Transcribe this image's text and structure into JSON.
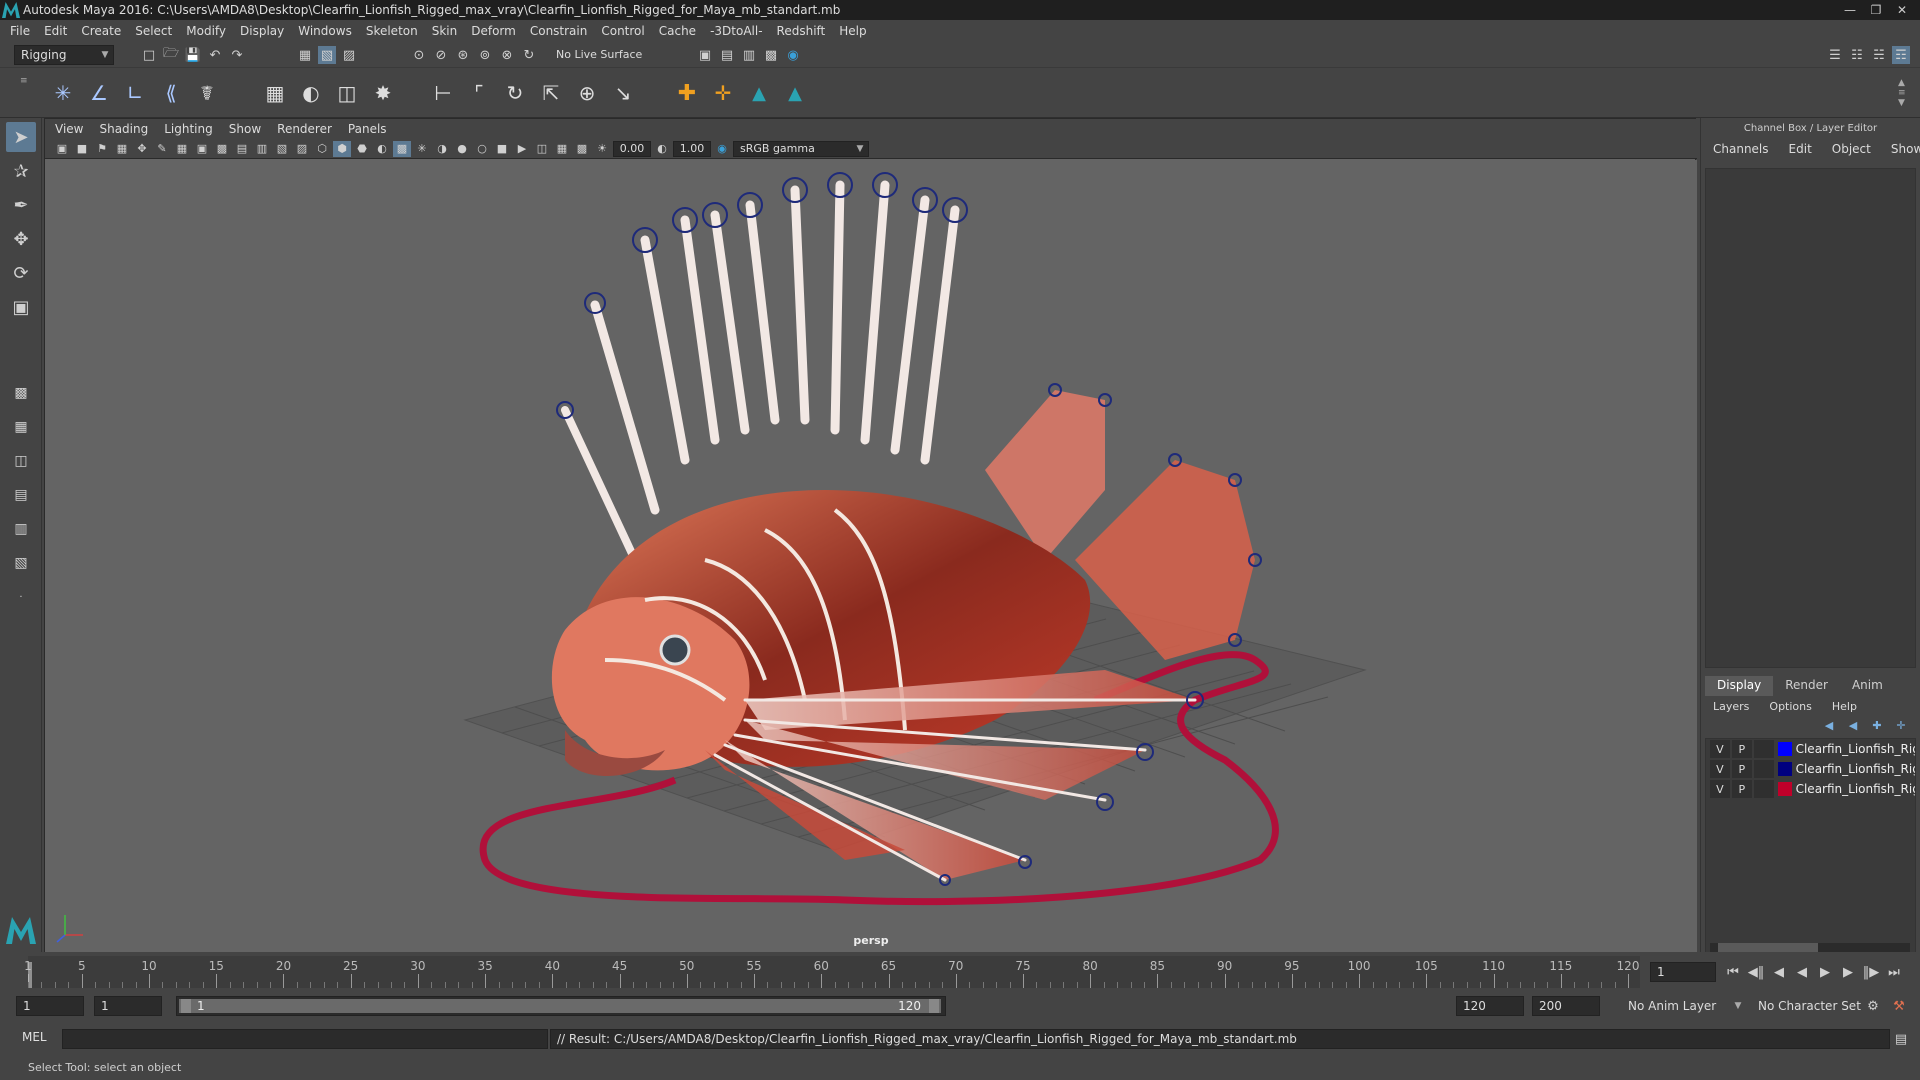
{
  "window": {
    "title": "Autodesk Maya 2016: C:\\Users\\AMDA8\\Desktop\\Clearfin_Lionfish_Rigged_max_vray\\Clearfin_Lionfish_Rigged_for_Maya_mb_standart.mb"
  },
  "menubar": [
    "File",
    "Edit",
    "Create",
    "Select",
    "Modify",
    "Display",
    "Windows",
    "Skeleton",
    "Skin",
    "Deform",
    "Constrain",
    "Control",
    "Cache",
    "-3DtoAll-",
    "Redshift",
    "Help"
  ],
  "statusline": {
    "mode": "Rigging",
    "live_surface": "No Live Surface"
  },
  "panel": {
    "menu": [
      "View",
      "Shading",
      "Lighting",
      "Show",
      "Renderer",
      "Panels"
    ],
    "exposure": "0.00",
    "gamma": "1.00",
    "color_space": "sRGB gamma",
    "camera": "persp"
  },
  "channelbox": {
    "title": "Channel Box / Layer Editor",
    "menu": [
      "Channels",
      "Edit",
      "Object",
      "Show"
    ],
    "layer_tabs": [
      "Display",
      "Render",
      "Anim"
    ],
    "layer_menu": [
      "Layers",
      "Options",
      "Help"
    ],
    "layers": [
      {
        "v": "V",
        "p": "P",
        "name": "Clearfin_Lionfish_Rigg",
        "color": "#0000ff"
      },
      {
        "v": "V",
        "p": "P",
        "name": "Clearfin_Lionfish_Rigg",
        "color": "#000080"
      },
      {
        "v": "V",
        "p": "P",
        "name": "Clearfin_Lionfish_Rigg",
        "color": "#c0002a"
      }
    ]
  },
  "timeslider": {
    "ticks": [
      5,
      10,
      15,
      20,
      25,
      30,
      35,
      40,
      45,
      50,
      55,
      60,
      65,
      70,
      75,
      80,
      85,
      90,
      95,
      100,
      105,
      110,
      115,
      120
    ],
    "start": "1",
    "current_frame": "1"
  },
  "range": {
    "start": "1",
    "playback_start": "1",
    "range_start_label": "1",
    "range_end_label": "120",
    "playback_end": "120",
    "end": "200",
    "anim_layer": "No Anim Layer",
    "character_set": "No Character Set"
  },
  "cmdline": {
    "label": "MEL",
    "result": "// Result: C:/Users/AMDA8/Desktop/Clearfin_Lionfish_Rigged_max_vray/Clearfin_Lionfish_Rigged_for_Maya_mb_standart.mb"
  },
  "helpline": "Select Tool: select an object"
}
